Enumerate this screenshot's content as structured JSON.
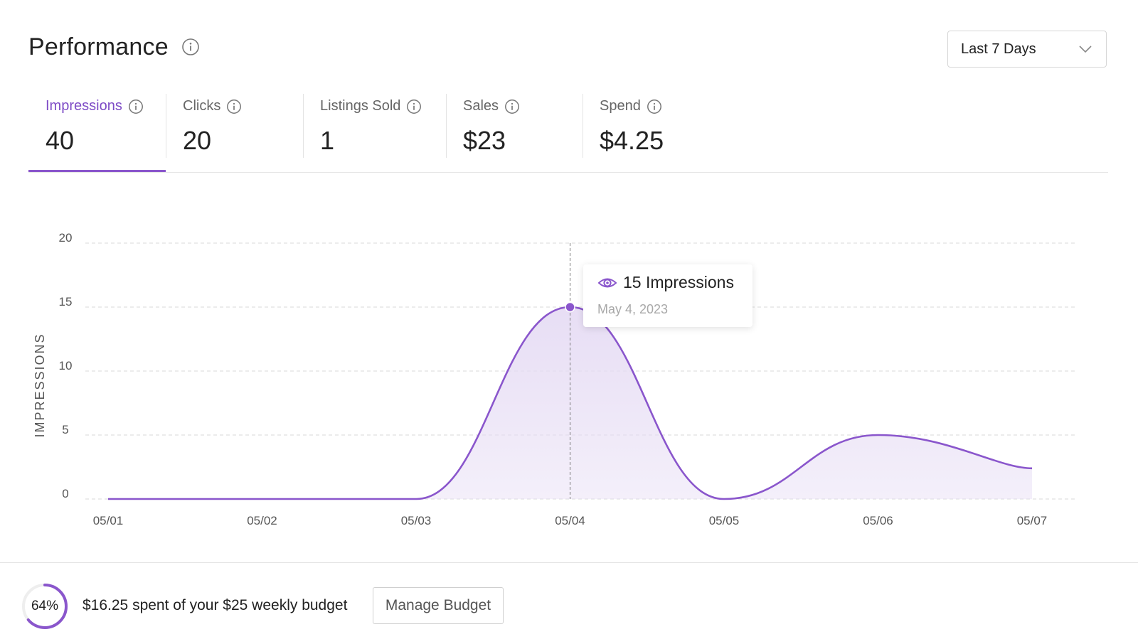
{
  "header": {
    "title": "Performance",
    "info_icon": "info-icon",
    "date_range": {
      "selected": "Last 7 Days",
      "icon": "chevron-down-icon"
    }
  },
  "metrics": [
    {
      "label": "Impressions",
      "value": "40",
      "active": true
    },
    {
      "label": "Clicks",
      "value": "20",
      "active": false
    },
    {
      "label": "Listings Sold",
      "value": "1",
      "active": false
    },
    {
      "label": "Sales",
      "value": "$23",
      "active": false
    },
    {
      "label": "Spend",
      "value": "$4.25",
      "active": false
    }
  ],
  "colors": {
    "accent": "#8a56cc",
    "accent_text": "#7e4cc6",
    "area_fill": "#e6dcf4",
    "grid": "#d9d9d9",
    "axis_text": "#555555"
  },
  "chart_data": {
    "type": "area",
    "ylabel": "IMPRESSIONS",
    "categories": [
      "05/01",
      "05/02",
      "05/03",
      "05/04",
      "05/05",
      "05/06",
      "05/07"
    ],
    "values": [
      0,
      0,
      0,
      15,
      0,
      5,
      2.4
    ],
    "yticks": [
      0,
      5,
      10,
      15,
      20
    ],
    "ylim": [
      0,
      20
    ],
    "grid": true,
    "highlight_index": 3
  },
  "tooltip": {
    "icon": "eye-icon",
    "count_text": "15 Impressions",
    "date_text": "May 4, 2023"
  },
  "budget": {
    "percent": 64,
    "percent_text": "64%",
    "text": "$16.25 spent of your $25 weekly budget",
    "button_label": "Manage Budget"
  }
}
